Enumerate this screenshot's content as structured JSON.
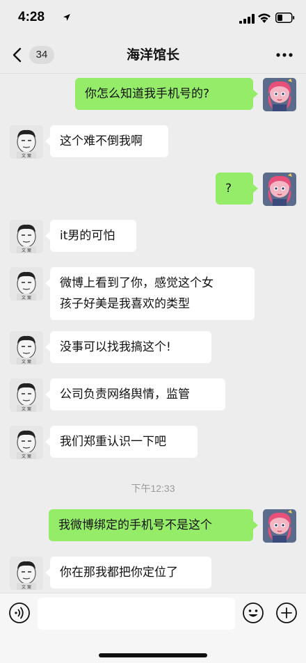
{
  "status_bar": {
    "time": "4:28",
    "icons": [
      "location-arrow-icon",
      "signal-icon",
      "wifi-icon",
      "battery-icon"
    ]
  },
  "nav": {
    "unread_count": "34",
    "title": "海洋馆长",
    "back_icon": "chevron-left-icon",
    "more_icon": "more-dots-icon"
  },
  "messages": [
    {
      "side": "right",
      "text": "你怎么知道我手机号的?"
    },
    {
      "side": "left",
      "text": "这个难不倒我啊"
    },
    {
      "side": "right",
      "text": "?"
    },
    {
      "side": "left",
      "text": "it男的可怕"
    },
    {
      "side": "left",
      "lines": [
        "微博上看到了你，感觉这个女",
        "孩子好美是我喜欢的类型"
      ]
    },
    {
      "side": "left",
      "text": "没事可以找我搞这个!"
    },
    {
      "side": "left",
      "text": "公司负责网络舆情，监管"
    },
    {
      "side": "left",
      "text": "我们郑重认识一下吧"
    },
    {
      "side": "time",
      "text": "下午12:33"
    },
    {
      "side": "right",
      "text": "我微博绑定的手机号不是这个"
    },
    {
      "side": "left",
      "text": "你在那我都把你定位了"
    }
  ],
  "input_bar": {
    "placeholder": "",
    "icons": [
      "voice-icon",
      "emoji-icon",
      "plus-icon"
    ]
  },
  "colors": {
    "background": "#ededed",
    "bubble_sent": "#95ec69",
    "bubble_received": "#ffffff",
    "timestamp": "#9b9b9b"
  }
}
